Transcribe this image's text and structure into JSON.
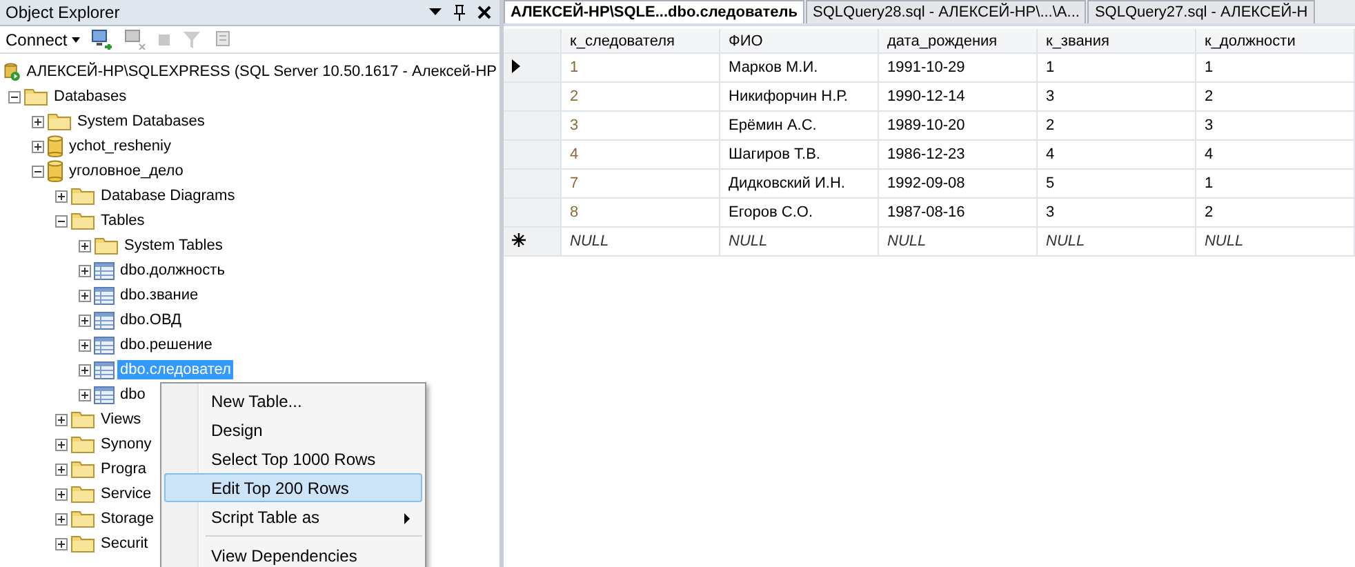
{
  "object_explorer": {
    "title": "Object Explorer",
    "toolbar": {
      "connect": "Connect"
    },
    "tree": [
      {
        "kind": "server",
        "label": "АЛЕКСЕЙ-HP\\SQLEXPRESS (SQL Server 10.50.1617 - Алексей-HP",
        "selected": false,
        "children": [
          {
            "kind": "folder",
            "label": "Databases",
            "expanded": true,
            "selected": false,
            "children": [
              {
                "kind": "folder",
                "label": "System Databases",
                "expanded": false,
                "selected": false
              },
              {
                "kind": "database",
                "label": "ychot_resheniy",
                "expanded": false,
                "selected": false
              },
              {
                "kind": "database",
                "label": "уголовное_дело",
                "expanded": true,
                "selected": false,
                "children": [
                  {
                    "kind": "folder",
                    "label": "Database Diagrams",
                    "expanded": false,
                    "selected": false
                  },
                  {
                    "kind": "folder",
                    "label": "Tables",
                    "expanded": true,
                    "selected": false,
                    "children": [
                      {
                        "kind": "folder",
                        "label": "System Tables",
                        "expanded": false,
                        "selected": false
                      },
                      {
                        "kind": "table",
                        "label": "dbo.должность",
                        "expanded": false,
                        "selected": false
                      },
                      {
                        "kind": "table",
                        "label": "dbo.звание",
                        "expanded": false,
                        "selected": false
                      },
                      {
                        "kind": "table",
                        "label": "dbo.ОВД",
                        "expanded": false,
                        "selected": false
                      },
                      {
                        "kind": "table",
                        "label": "dbo.решение",
                        "expanded": false,
                        "selected": false
                      },
                      {
                        "kind": "table",
                        "label": "dbo.следовател",
                        "expanded": false,
                        "selected": true
                      },
                      {
                        "kind": "table",
                        "label": "dbo",
                        "expanded": false,
                        "selected": false
                      }
                    ]
                  },
                  {
                    "kind": "folder",
                    "label": "Views",
                    "expanded": false,
                    "selected": false
                  },
                  {
                    "kind": "folder",
                    "label": "Synony",
                    "expanded": false,
                    "selected": false
                  },
                  {
                    "kind": "folder",
                    "label": "Progra",
                    "expanded": false,
                    "selected": false
                  },
                  {
                    "kind": "folder",
                    "label": "Service",
                    "expanded": false,
                    "selected": false
                  },
                  {
                    "kind": "folder",
                    "label": "Storage",
                    "expanded": false,
                    "selected": false
                  },
                  {
                    "kind": "folder",
                    "label": "Securit",
                    "expanded": false,
                    "selected": false
                  }
                ]
              }
            ]
          }
        ]
      }
    ]
  },
  "context_menu": [
    {
      "kind": "item",
      "label": "New Table...",
      "selected": false
    },
    {
      "kind": "item",
      "label": "Design",
      "selected": false
    },
    {
      "kind": "item",
      "label": "Select Top 1000 Rows",
      "selected": false
    },
    {
      "kind": "item",
      "label": "Edit Top 200 Rows",
      "selected": true
    },
    {
      "kind": "submenu",
      "label": "Script Table as",
      "selected": false
    },
    {
      "kind": "separator"
    },
    {
      "kind": "item",
      "label": "View Dependencies",
      "selected": false
    }
  ],
  "tabs": [
    {
      "label": "АЛЕКСЕЙ-HP\\SQLE...dbo.следователь",
      "selected": true
    },
    {
      "label": "SQLQuery28.sql - АЛЕКСЕЙ-HP\\...\\А...",
      "selected": false
    },
    {
      "label": "SQLQuery27.sql - АЛЕКСЕЙ-Н",
      "selected": false
    }
  ],
  "grid": {
    "columns": [
      "к_следователя",
      "ФИО",
      "дата_рождения",
      "к_звания",
      "к_должности"
    ],
    "rows": [
      {
        "kind": "current",
        "cells": [
          "1",
          "Марков М.И.",
          "1991-10-29",
          "1",
          "1"
        ]
      },
      {
        "kind": "data",
        "cells": [
          "2",
          "Никифорчин Н.Р.",
          "1990-12-14",
          "3",
          "2"
        ]
      },
      {
        "kind": "data",
        "cells": [
          "3",
          "Ерёмин А.С.",
          "1989-10-20",
          "2",
          "3"
        ]
      },
      {
        "kind": "data",
        "cells": [
          "4",
          "Шагиров Т.В.",
          "1986-12-23",
          "4",
          "4"
        ]
      },
      {
        "kind": "data",
        "cells": [
          "7",
          "Дидковский И.Н.",
          "1992-09-08",
          "5",
          "1"
        ]
      },
      {
        "kind": "data",
        "cells": [
          "8",
          "Егоров С.О.",
          "1987-08-16",
          "3",
          "2"
        ]
      },
      {
        "kind": "new",
        "cells": [
          "NULL",
          "NULL",
          "NULL",
          "NULL",
          "NULL"
        ]
      }
    ]
  }
}
